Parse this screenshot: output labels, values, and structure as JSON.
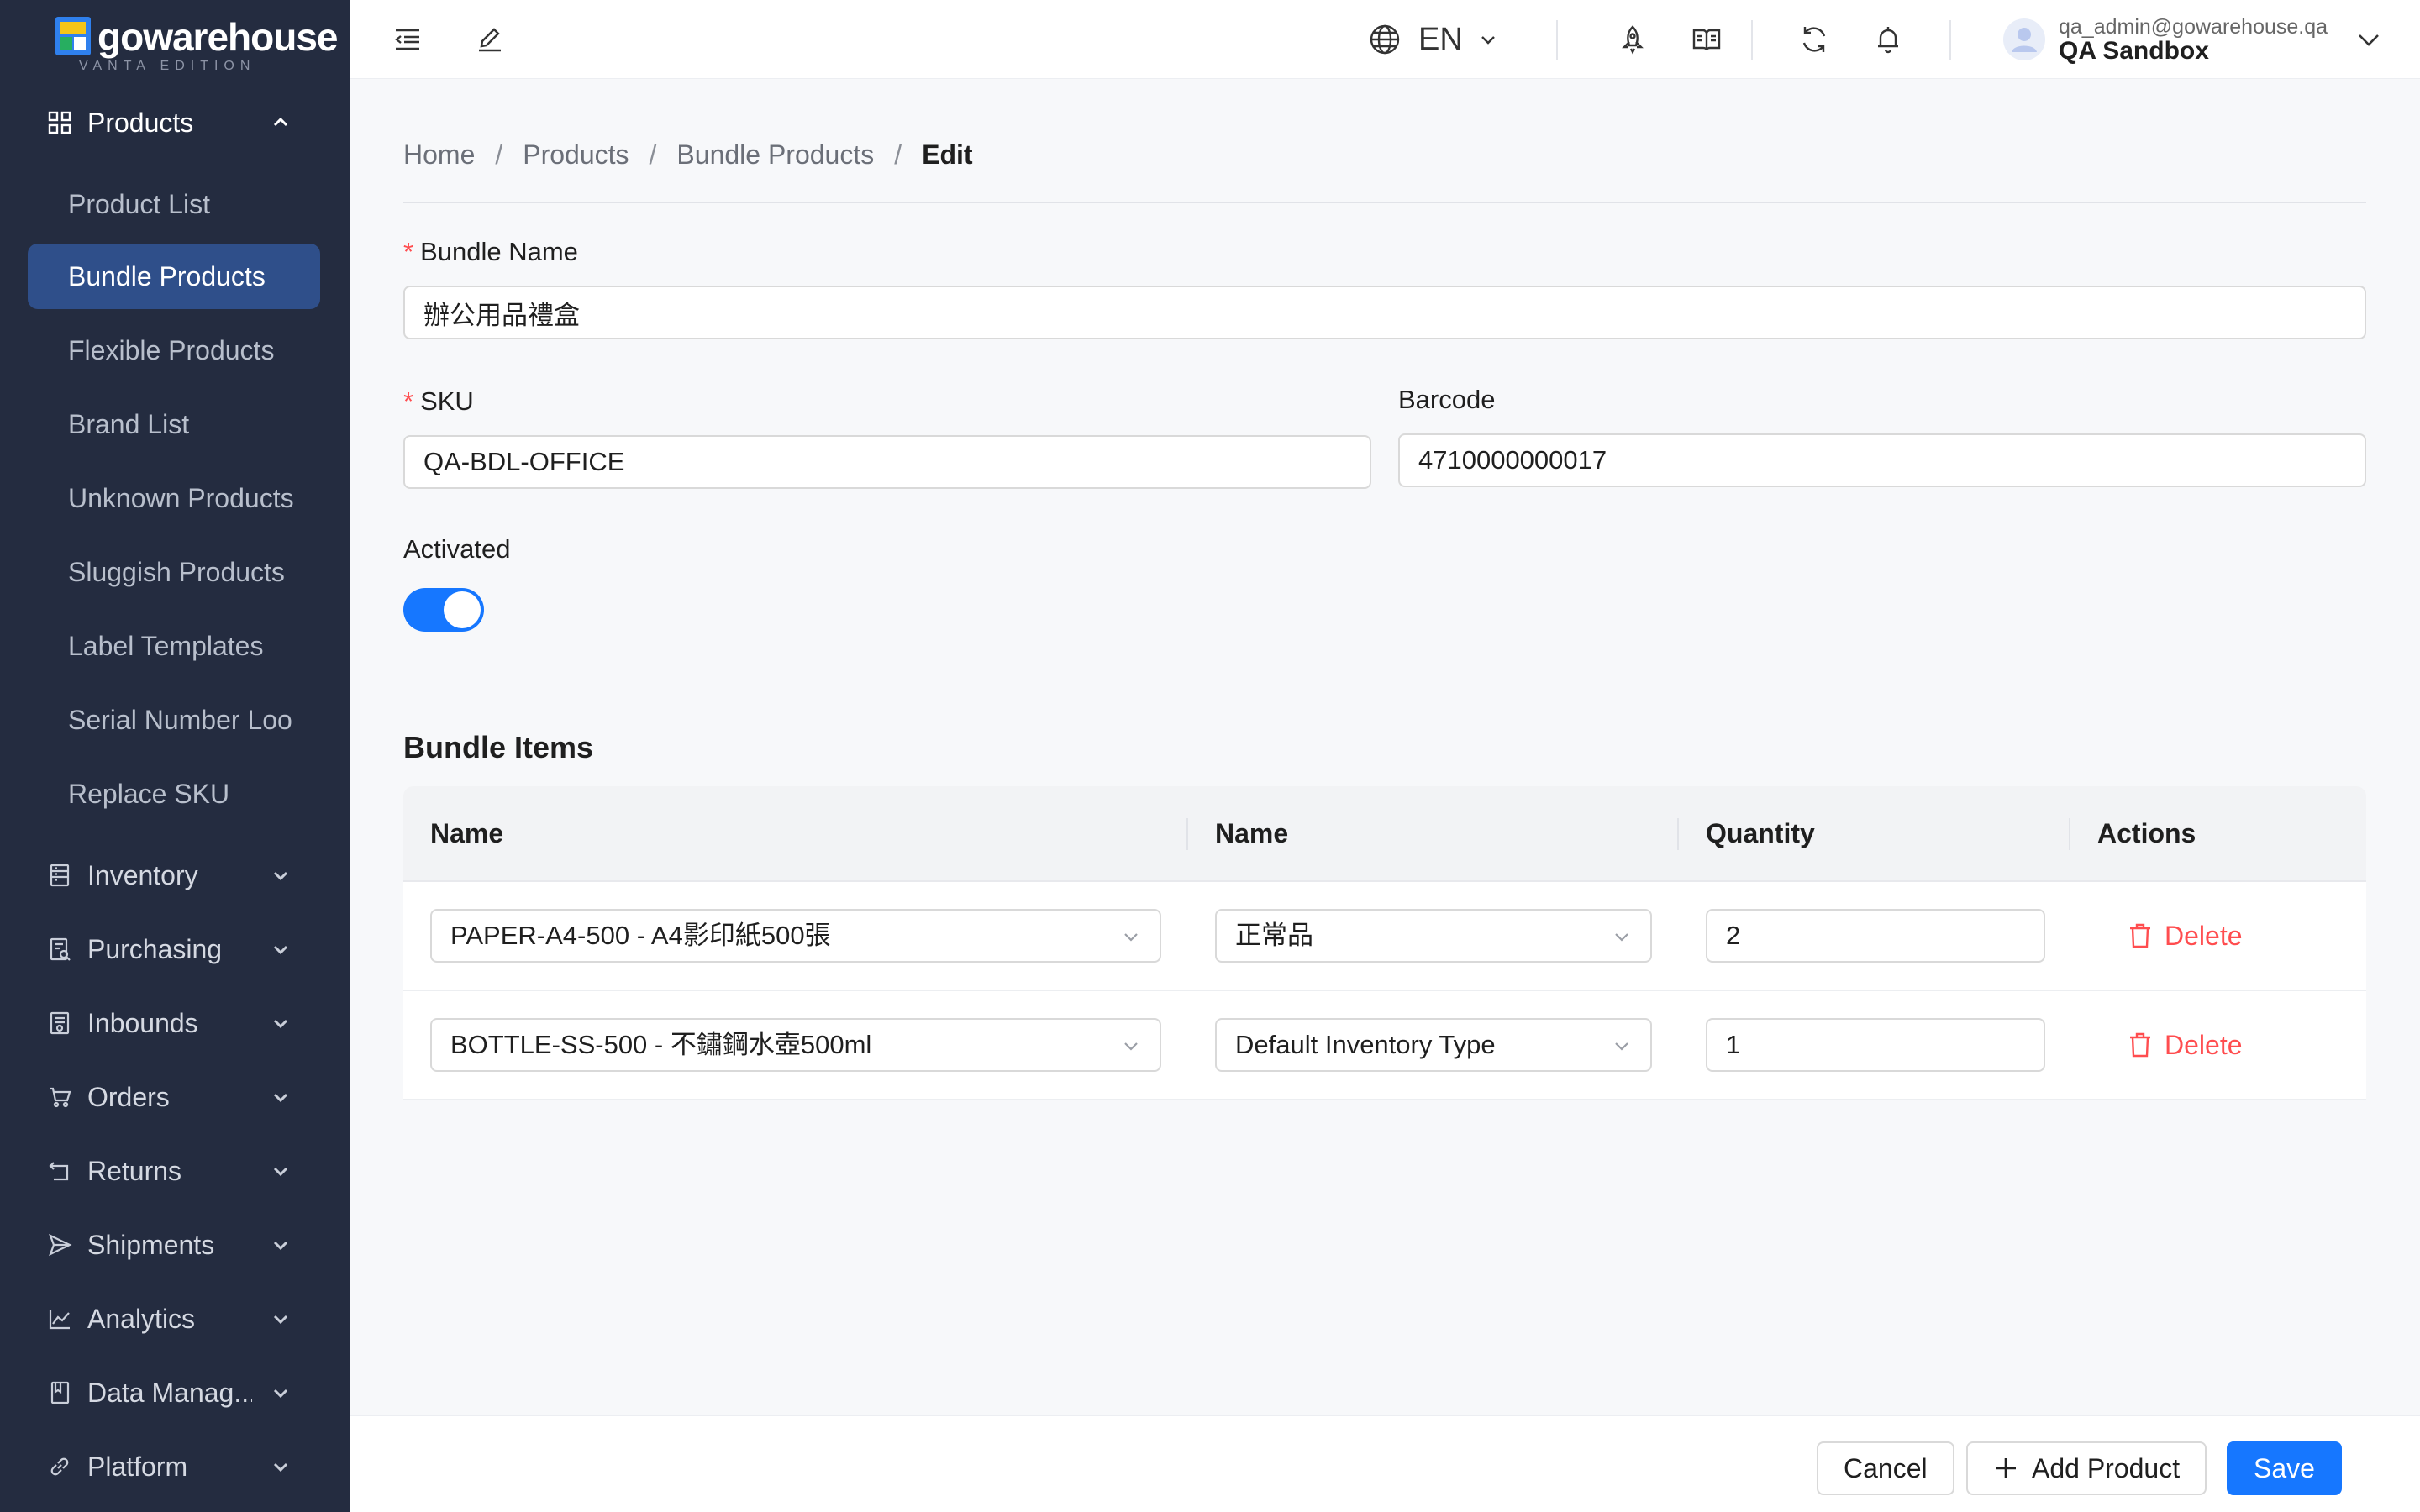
{
  "brand": {
    "name": "gowarehouse",
    "edition": "VANTA EDITION",
    "logo_colors": [
      "#f5c518",
      "#2f80ed",
      "#27ae60"
    ]
  },
  "sidebar": {
    "products": {
      "label": "Products",
      "items": [
        "Product List",
        "Bundle Products",
        "Flexible Products",
        "Brand List",
        "Unknown Products",
        "Sluggish Products",
        "Label Templates",
        "Serial Number Loo",
        "Replace SKU"
      ],
      "active_index": 1
    },
    "groups": [
      {
        "label": "Inventory",
        "icon": "inventory-icon"
      },
      {
        "label": "Purchasing",
        "icon": "purchasing-icon"
      },
      {
        "label": "Inbounds",
        "icon": "inbounds-icon"
      },
      {
        "label": "Orders",
        "icon": "cart-icon"
      },
      {
        "label": "Returns",
        "icon": "return-icon"
      },
      {
        "label": "Shipments",
        "icon": "send-icon"
      },
      {
        "label": "Analytics",
        "icon": "chart-icon"
      },
      {
        "label": "Data Manag...",
        "icon": "book-icon"
      },
      {
        "label": "Platform",
        "icon": "link-icon"
      }
    ]
  },
  "header": {
    "language": "EN",
    "user_email": "qa_admin@gowarehouse.qa",
    "user_org": "QA Sandbox",
    "icons": [
      "menu-fold-icon",
      "edit-icon",
      "globe-icon",
      "rocket-icon",
      "read-icon",
      "sync-icon",
      "bell-icon"
    ]
  },
  "breadcrumb": {
    "home": "Home",
    "products": "Products",
    "bundle_products": "Bundle Products",
    "current": "Edit",
    "separator": "/"
  },
  "form": {
    "bundle_name_label": "Bundle Name",
    "bundle_name_value": "辦公用品禮盒",
    "sku_label": "SKU",
    "sku_value": "QA-BDL-OFFICE",
    "barcode_label": "Barcode",
    "barcode_value": "4710000000017",
    "activated_label": "Activated",
    "activated": true,
    "required_mark": "*"
  },
  "bundle_items": {
    "title": "Bundle Items",
    "columns": [
      "Name",
      "Name",
      "Quantity",
      "Actions"
    ],
    "rows": [
      {
        "product": "PAPER-A4-500 - A4影印紙500張",
        "inventory_type": "正常品",
        "quantity": "2",
        "action": "Delete"
      },
      {
        "product": "BOTTLE-SS-500 - 不鏽鋼水壺500ml",
        "inventory_type": "Default Inventory Type",
        "quantity": "1",
        "action": "Delete"
      }
    ]
  },
  "footer": {
    "cancel": "Cancel",
    "add_product": "Add Product",
    "save": "Save"
  },
  "colors": {
    "sidebar_bg": "#242c40",
    "active_item": "#2f4f8a",
    "primary": "#1677ff",
    "danger": "#ff4d4f"
  }
}
